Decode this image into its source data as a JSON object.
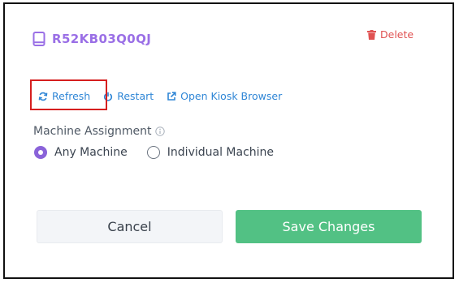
{
  "device": {
    "name": "R52KB03Q0QJ"
  },
  "header": {
    "delete_label": "Delete"
  },
  "actions": {
    "refresh_label": "Refresh",
    "restart_label": "Restart",
    "open_kiosk_label": "Open Kiosk Browser"
  },
  "assignment": {
    "label": "Machine Assignment",
    "options": [
      {
        "label": "Any Machine",
        "selected": true
      },
      {
        "label": "Individual Machine",
        "selected": false
      }
    ]
  },
  "buttons": {
    "cancel_label": "Cancel",
    "save_label": "Save Changes"
  },
  "colors": {
    "title": "#9a6fe6",
    "link": "#2f86d6",
    "delete": "#e05252",
    "save": "#52c184",
    "radio_selected": "#8a63d9",
    "highlight": "#d61f1f"
  }
}
